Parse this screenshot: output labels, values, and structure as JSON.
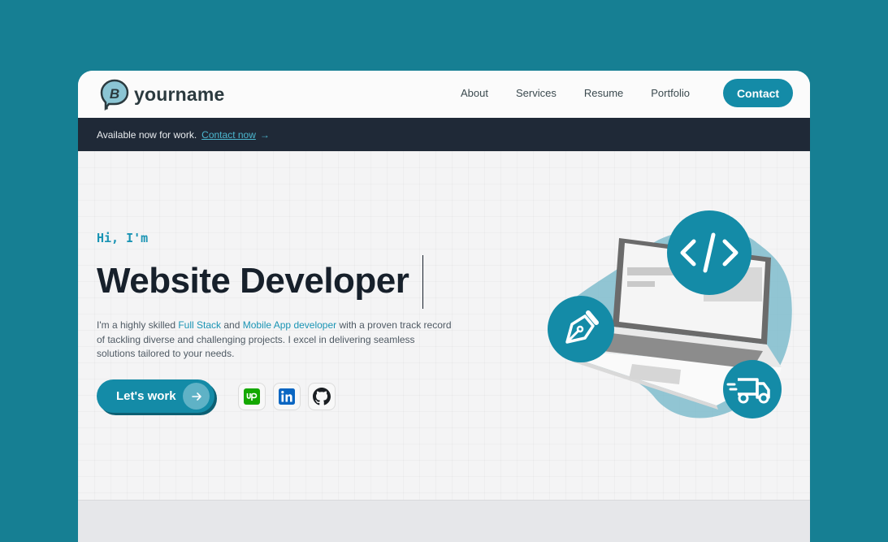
{
  "header": {
    "logo_letter": "B",
    "brand": "yourname",
    "nav": [
      {
        "label": "About"
      },
      {
        "label": "Services"
      },
      {
        "label": "Resume"
      },
      {
        "label": "Portfolio"
      }
    ],
    "contact_label": "Contact"
  },
  "banner": {
    "text": "Available now for work.",
    "link_label": "Contact now",
    "arrow": "→"
  },
  "hero": {
    "greeting": "Hi, I'm",
    "headline": "Website Developer",
    "description": {
      "part1": "I'm a highly skilled ",
      "highlight1": "Full Stack",
      "part2": " and ",
      "highlight2": "Mobile App developer",
      "part3": " with a proven track record of tackling diverse and challenging projects. I excel in delivering seamless solutions tailored to your needs."
    },
    "cta_label": "Let's work",
    "socials": [
      {
        "icon": "upwork-icon"
      },
      {
        "icon": "linkedin-icon"
      },
      {
        "icon": "github-icon"
      }
    ]
  },
  "colors": {
    "background": "#167f93",
    "accent": "#148ba7",
    "banner": "#1f2937",
    "heading": "#17202b"
  }
}
